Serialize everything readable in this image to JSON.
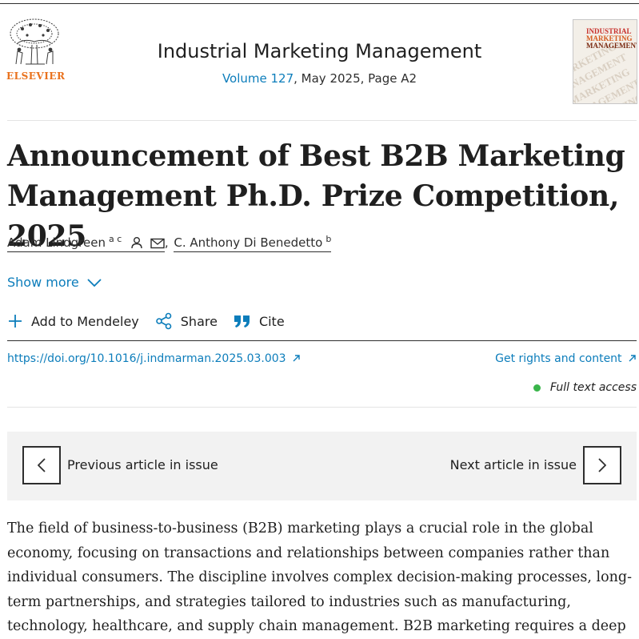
{
  "publisher": {
    "name": "ELSEVIER"
  },
  "journal": {
    "title": "Industrial Marketing Management",
    "volume_link": "Volume 127",
    "issue_info": ", May 2025, Page A2",
    "cover_lines": [
      "INDUSTRIAL",
      "MARKETING",
      "MANAGEMENT"
    ]
  },
  "article": {
    "title_lines": [
      "Announcement of Best B2B Marketing",
      "Management Ph.D. Prize Competition, 2025"
    ],
    "authors": [
      {
        "name": "Adam Lindgreen",
        "affil": "a c"
      },
      {
        "name": "C. Anthony Di Benedetto",
        "affil": "b"
      }
    ],
    "author_separator": ",",
    "show_more": "Show more",
    "actions": {
      "mendeley": "Add to Mendeley",
      "share": "Share",
      "cite": "Cite"
    },
    "doi": "https://doi.org/10.1016/j.indmarman.2025.03.003",
    "rights": "Get rights and content",
    "access": "Full text access"
  },
  "issue_nav": {
    "previous": "Previous article in issue",
    "next": "Next article in issue"
  },
  "body_lines": [
    "The field of business-to-business (B2B) marketing plays a crucial role in the global",
    "economy, focusing on transactions and relationships between companies rather than",
    "individual consumers. The discipline involves complex decision-making processes, long-",
    "term partnerships, and strategies tailored to industries such as manufacturing,",
    "technology, healthcare, and supply chain management. B2B marketing requires a deep"
  ],
  "colors": {
    "link": "#0c7dbb",
    "brand_orange": "#e9711c",
    "access_green": "#39b54a",
    "nav_bg": "#f2f2f2"
  }
}
